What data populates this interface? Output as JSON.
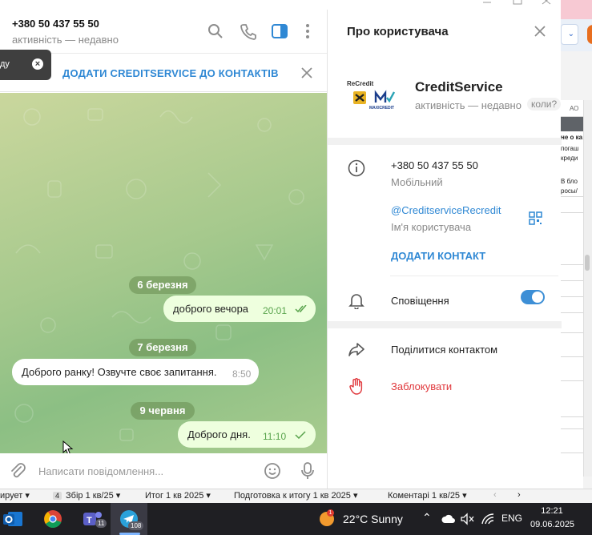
{
  "header": {
    "contact_phone": "+380 50 437 55 50",
    "status": "активність — недавно"
  },
  "add_bar": {
    "link": "ДОДАТИ CREDITSERVICE ДО КОНТАКТІВ"
  },
  "toast": {
    "text": "ду"
  },
  "messages": [
    {
      "type": "date",
      "text": "6 березня"
    },
    {
      "type": "out",
      "text": "доброго вечора",
      "time": "20:01"
    },
    {
      "type": "date",
      "text": "7 березня"
    },
    {
      "type": "in",
      "text": "Доброго ранку! Озвучте своє запитання.",
      "time": "8:50"
    },
    {
      "type": "date",
      "text": "9 червня"
    },
    {
      "type": "out",
      "text": "Доброго дня.",
      "time": "11:10"
    }
  ],
  "composer": {
    "placeholder": "Написати повідомлення..."
  },
  "panel": {
    "title": "Про користувача",
    "name": "CreditService",
    "status": "активність — недавно",
    "badge": "коли?",
    "logo_top": "ReCredit",
    "logo_bottom": "MAXICREDIT",
    "phone": "+380 50 437 55 50",
    "phone_label": "Мобільний",
    "username": "@CreditserviceRecredit",
    "username_label": "Ім'я користувача",
    "add_contact": "ДОДАТИ КОНТАКТ",
    "notifications": "Сповіщення",
    "notifications_on": true,
    "share": "Поділитися контактом",
    "block": "Заблокувати"
  },
  "colors": {
    "accent": "#2f88d4",
    "danger": "#e0383c",
    "out_bubble": "#eeffde",
    "read_check": "#58a34c"
  },
  "background_app": {
    "dropdown_arrow": "⌄",
    "cell_snippets": [
      "АО",
      "не о ка",
      "погаш",
      "креди",
      "В бло",
      "росы/"
    ]
  },
  "sheet_tabs": [
    {
      "label": "ирует"
    },
    {
      "num": "4",
      "label": "Збір 1 кв/25"
    },
    {
      "label": "Итог 1 кв 2025"
    },
    {
      "label": "Подготовка к итогу 1 кв 2025"
    },
    {
      "label": "Коментарі 1 кв/25"
    }
  ],
  "taskbar": {
    "apps": [
      {
        "icon": "outlook-icon"
      },
      {
        "icon": "chrome-icon"
      },
      {
        "icon": "teams-icon",
        "badge": "11"
      },
      {
        "icon": "telegram-icon",
        "badge": "108"
      }
    ],
    "weather_badge": "1",
    "weather": "22°C  Sunny",
    "lang": "ENG",
    "time": "12:21",
    "date": "09.06.2025"
  }
}
